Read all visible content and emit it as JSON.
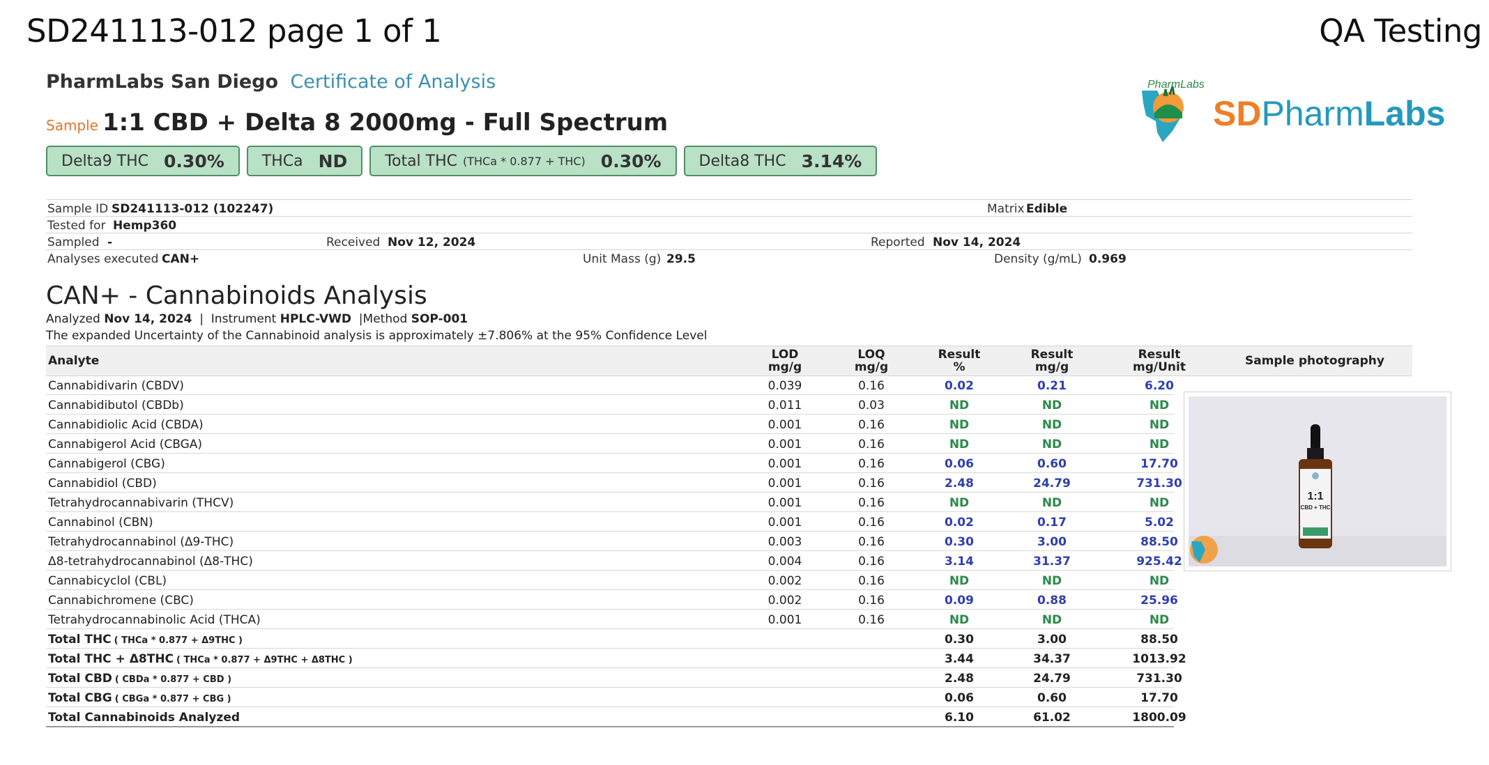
{
  "header": {
    "doc_id": "SD241113-012 page 1 of 1",
    "right_title": "QA Testing"
  },
  "lab": {
    "name": "PharmLabs San Diego",
    "cert": "Certificate of Analysis",
    "logo_text_sd": "SD",
    "logo_text_pharm": "Pharm",
    "logo_text_labs": "Labs",
    "logo_arc_text": "PharmLabs"
  },
  "sample": {
    "tag": "Sample",
    "name": "1:1 CBD + Delta 8 2000mg - Full Spectrum"
  },
  "badges": [
    {
      "label": "Delta9 THC",
      "small": "",
      "value": "0.30%"
    },
    {
      "label": "THCa",
      "small": "",
      "value": "ND"
    },
    {
      "label": "Total THC",
      "small": "(THCa * 0.877 + THC)",
      "value": "0.30%"
    },
    {
      "label": "Delta8 THC",
      "small": "",
      "value": "3.14%"
    }
  ],
  "info": {
    "sample_id_label": "Sample ID",
    "sample_id": "SD241113-012 (102247)",
    "matrix_label": "Matrix",
    "matrix": "Edible",
    "tested_for_label": "Tested for",
    "tested_for": "Hemp360",
    "sampled_label": "Sampled",
    "sampled": "-",
    "received_label": "Received",
    "received": "Nov 12, 2024",
    "reported_label": "Reported",
    "reported": "Nov 14, 2024",
    "analyses_label": "Analyses executed",
    "analyses": "CAN+",
    "unit_mass_label": "Unit Mass (g)",
    "unit_mass": "29.5",
    "density_label": "Density (g/mL)",
    "density": "0.969"
  },
  "section": {
    "title": "CAN+ - Cannabinoids Analysis",
    "analyzed_label": "Analyzed",
    "analyzed": "Nov 14, 2024",
    "instrument_label": "Instrument",
    "instrument": "HPLC-VWD",
    "method_label": "Method",
    "method": "SOP-001",
    "uncertainty": "The expanded Uncertainty of the Cannabinoid analysis is approximately ±7.806% at the 95% Confidence Level"
  },
  "table": {
    "headers": {
      "analyte": "Analyte",
      "lod": "LOD",
      "lod_unit": "mg/g",
      "loq": "LOQ",
      "loq_unit": "mg/g",
      "r1": "Result",
      "r1_unit": "%",
      "r2": "Result",
      "r2_unit": "mg/g",
      "r3": "Result",
      "r3_unit": "mg/Unit",
      "photo": "Sample photography"
    },
    "rows": [
      {
        "name": "Cannabidivarin (CBDV)",
        "formula": "",
        "lod": "0.039",
        "loq": "0.16",
        "pct": "0.02",
        "mgg": "0.21",
        "mgu": "6.20",
        "kind": "num"
      },
      {
        "name": "Cannabidibutol (CBDb)",
        "formula": "",
        "lod": "0.011",
        "loq": "0.03",
        "pct": "ND",
        "mgg": "ND",
        "mgu": "ND",
        "kind": "nd"
      },
      {
        "name": "Cannabidiolic Acid (CBDA)",
        "formula": "",
        "lod": "0.001",
        "loq": "0.16",
        "pct": "ND",
        "mgg": "ND",
        "mgu": "ND",
        "kind": "nd"
      },
      {
        "name": "Cannabigerol Acid (CBGA)",
        "formula": "",
        "lod": "0.001",
        "loq": "0.16",
        "pct": "ND",
        "mgg": "ND",
        "mgu": "ND",
        "kind": "nd"
      },
      {
        "name": "Cannabigerol (CBG)",
        "formula": "",
        "lod": "0.001",
        "loq": "0.16",
        "pct": "0.06",
        "mgg": "0.60",
        "mgu": "17.70",
        "kind": "num"
      },
      {
        "name": "Cannabidiol (CBD)",
        "formula": "",
        "lod": "0.001",
        "loq": "0.16",
        "pct": "2.48",
        "mgg": "24.79",
        "mgu": "731.30",
        "kind": "num"
      },
      {
        "name": "Tetrahydrocannabivarin (THCV)",
        "formula": "",
        "lod": "0.001",
        "loq": "0.16",
        "pct": "ND",
        "mgg": "ND",
        "mgu": "ND",
        "kind": "nd"
      },
      {
        "name": "Cannabinol (CBN)",
        "formula": "",
        "lod": "0.001",
        "loq": "0.16",
        "pct": "0.02",
        "mgg": "0.17",
        "mgu": "5.02",
        "kind": "num"
      },
      {
        "name": "Tetrahydrocannabinol (Δ9-THC)",
        "formula": "",
        "lod": "0.003",
        "loq": "0.16",
        "pct": "0.30",
        "mgg": "3.00",
        "mgu": "88.50",
        "kind": "num"
      },
      {
        "name": "Δ8-tetrahydrocannabinol (Δ8-THC)",
        "formula": "",
        "lod": "0.004",
        "loq": "0.16",
        "pct": "3.14",
        "mgg": "31.37",
        "mgu": "925.42",
        "kind": "num"
      },
      {
        "name": "Cannabicyclol (CBL)",
        "formula": "",
        "lod": "0.002",
        "loq": "0.16",
        "pct": "ND",
        "mgg": "ND",
        "mgu": "ND",
        "kind": "nd"
      },
      {
        "name": "Cannabichromene (CBC)",
        "formula": "",
        "lod": "0.002",
        "loq": "0.16",
        "pct": "0.09",
        "mgg": "0.88",
        "mgu": "25.96",
        "kind": "num"
      },
      {
        "name": "Tetrahydrocannabinolic Acid (THCA)",
        "formula": "",
        "lod": "0.001",
        "loq": "0.16",
        "pct": "ND",
        "mgg": "ND",
        "mgu": "ND",
        "kind": "nd"
      },
      {
        "name": "Total THC",
        "formula": "( THCa * 0.877 + Δ9THC )",
        "lod": "",
        "loq": "",
        "pct": "0.30",
        "mgg": "3.00",
        "mgu": "88.50",
        "kind": "tot"
      },
      {
        "name": "Total THC + Δ8THC",
        "formula": "( THCa * 0.877 + Δ9THC + Δ8THC )",
        "lod": "",
        "loq": "",
        "pct": "3.44",
        "mgg": "34.37",
        "mgu": "1013.92",
        "kind": "tot"
      },
      {
        "name": "Total CBD",
        "formula": "( CBDa * 0.877 + CBD )",
        "lod": "",
        "loq": "",
        "pct": "2.48",
        "mgg": "24.79",
        "mgu": "731.30",
        "kind": "tot"
      },
      {
        "name": "Total CBG",
        "formula": "( CBGa * 0.877 + CBG )",
        "lod": "",
        "loq": "",
        "pct": "0.06",
        "mgg": "0.60",
        "mgu": "17.70",
        "kind": "tot"
      },
      {
        "name": "Total Cannabinoids Analyzed",
        "formula": "",
        "lod": "",
        "loq": "",
        "pct": "6.10",
        "mgg": "61.02",
        "mgu": "1800.09",
        "kind": "tot"
      }
    ]
  },
  "photo": {
    "bottle_label_big": "1:1",
    "bottle_label_small": "CBD + THC"
  },
  "colors": {
    "badge_bg": "#b9e1c6",
    "badge_border": "#4d8f63",
    "result_blue": "#2f3fae",
    "nd_green": "#2c8a4a",
    "sample_orange": "#e8742a",
    "cert_blue": "#3b8fb0"
  }
}
